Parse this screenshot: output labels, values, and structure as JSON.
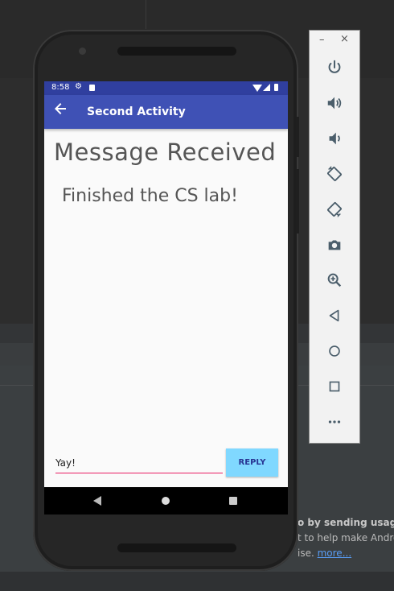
{
  "status_bar": {
    "time": "8:58"
  },
  "app_bar": {
    "title": "Second Activity"
  },
  "content": {
    "heading": "Message Received",
    "message": "Finished the CS lab!"
  },
  "reply": {
    "input_value": "Yay!",
    "button_label": "REPLY"
  },
  "notification": {
    "line1": "o by sending usage s",
    "line2": "t to help make Androi",
    "line3_prefix": "ise. ",
    "link": "more..."
  },
  "emulator_toolbar": {
    "minimize": "–",
    "close": "×",
    "buttons": [
      "power-icon",
      "volume-up-icon",
      "volume-down-icon",
      "rotate-left-icon",
      "rotate-right-icon",
      "camera-icon",
      "zoom-icon",
      "back-icon",
      "home-icon",
      "overview-icon",
      "more-icon"
    ]
  },
  "colors": {
    "app_bar": "#3f51b5",
    "status_bar": "#303f9f",
    "reply_button": "#80d8ff",
    "input_underline": "#e91e63"
  }
}
